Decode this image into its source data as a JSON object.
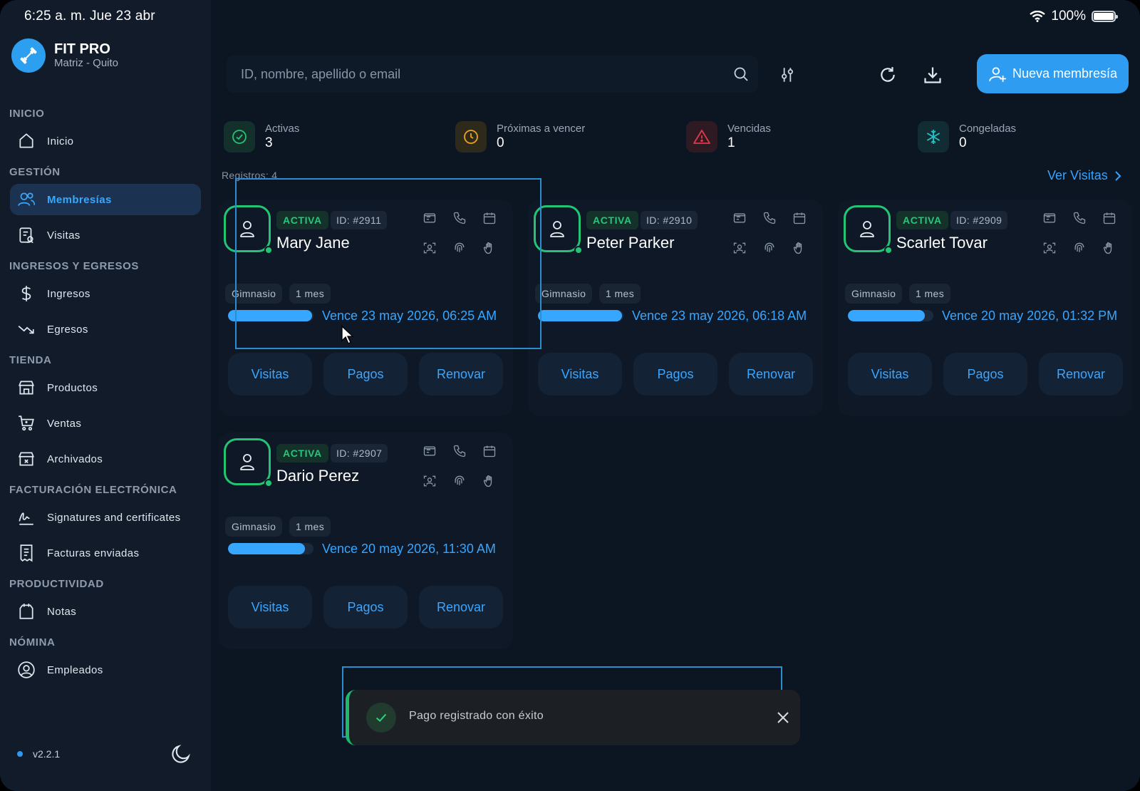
{
  "status_bar": {
    "time": "6:25 a. m.  Jue 23 abr",
    "battery": "100%"
  },
  "brand": {
    "name": "FIT PRO",
    "branch": "Matriz - Quito"
  },
  "sidebar": {
    "sections": [
      {
        "title": "INICIO",
        "items": [
          {
            "label": "Inicio",
            "icon": "home-icon"
          }
        ]
      },
      {
        "title": "GESTIÓN",
        "items": [
          {
            "label": "Membresías",
            "icon": "users-icon",
            "active": true
          },
          {
            "label": "Visitas",
            "icon": "visits-icon"
          }
        ]
      },
      {
        "title": "INGRESOS Y EGRESOS",
        "items": [
          {
            "label": "Ingresos",
            "icon": "dollar-icon"
          },
          {
            "label": "Egresos",
            "icon": "trend-down-icon"
          }
        ]
      },
      {
        "title": "TIENDA",
        "items": [
          {
            "label": "Productos",
            "icon": "store-icon"
          },
          {
            "label": "Ventas",
            "icon": "cart-icon"
          },
          {
            "label": "Archivados",
            "icon": "archive-store-icon"
          }
        ]
      },
      {
        "title": "FACTURACIÓN ELECTRÓNICA",
        "items": [
          {
            "label": "Signatures and certificates",
            "icon": "signature-icon"
          },
          {
            "label": "Facturas enviadas",
            "icon": "invoice-icon"
          }
        ]
      },
      {
        "title": "PRODUCTIVIDAD",
        "items": [
          {
            "label": "Notas",
            "icon": "notes-icon"
          }
        ]
      },
      {
        "title": "NÓMINA",
        "items": [
          {
            "label": "Empleados",
            "icon": "employee-icon"
          }
        ]
      }
    ],
    "version": "v2.2.1"
  },
  "search": {
    "placeholder": "ID, nombre, apellido o email",
    "value": ""
  },
  "toolbar": {
    "new_button": "Nueva membresía"
  },
  "stats": [
    {
      "label": "Activas",
      "value": "3",
      "color": "#23c574",
      "icon": "check-circle-icon"
    },
    {
      "label": "Próximas a vencer",
      "value": "0",
      "color": "#f0a21c",
      "icon": "clock-icon"
    },
    {
      "label": "Vencidas",
      "value": "1",
      "color": "#e0394a",
      "icon": "warning-icon"
    },
    {
      "label": "Congeladas",
      "value": "0",
      "color": "#23c4c9",
      "icon": "snowflake-icon"
    }
  ],
  "records_label": "Registros: 4",
  "view_visits_link": "Ver Visitas",
  "members": [
    {
      "status": "ACTIVA",
      "id": "ID: #2911",
      "name": "Mary Jane",
      "tags": [
        "Gimnasio",
        "1 mes"
      ],
      "progress": 0.98,
      "expiry": "Vence 23 may 2026, 06:25 AM"
    },
    {
      "status": "ACTIVA",
      "id": "ID: #2910",
      "name": "Peter Parker",
      "tags": [
        "Gimnasio",
        "1 mes"
      ],
      "progress": 0.98,
      "expiry": "Vence 23 may 2026, 06:18 AM"
    },
    {
      "status": "ACTIVA",
      "id": "ID: #2909",
      "name": "Scarlet Tovar",
      "tags": [
        "Gimnasio",
        "1 mes"
      ],
      "progress": 0.9,
      "expiry": "Vence 20 may 2026, 01:32 PM"
    },
    {
      "status": "ACTIVA",
      "id": "ID: #2907",
      "name": "Dario Perez",
      "tags": [
        "Gimnasio",
        "1 mes"
      ],
      "progress": 0.9,
      "expiry": "Vence 20 may 2026, 11:30 AM"
    }
  ],
  "card_actions": {
    "visits": "Visitas",
    "payments": "Pagos",
    "renew": "Renovar"
  },
  "toast": {
    "message": "Pago registrado con éxito"
  }
}
